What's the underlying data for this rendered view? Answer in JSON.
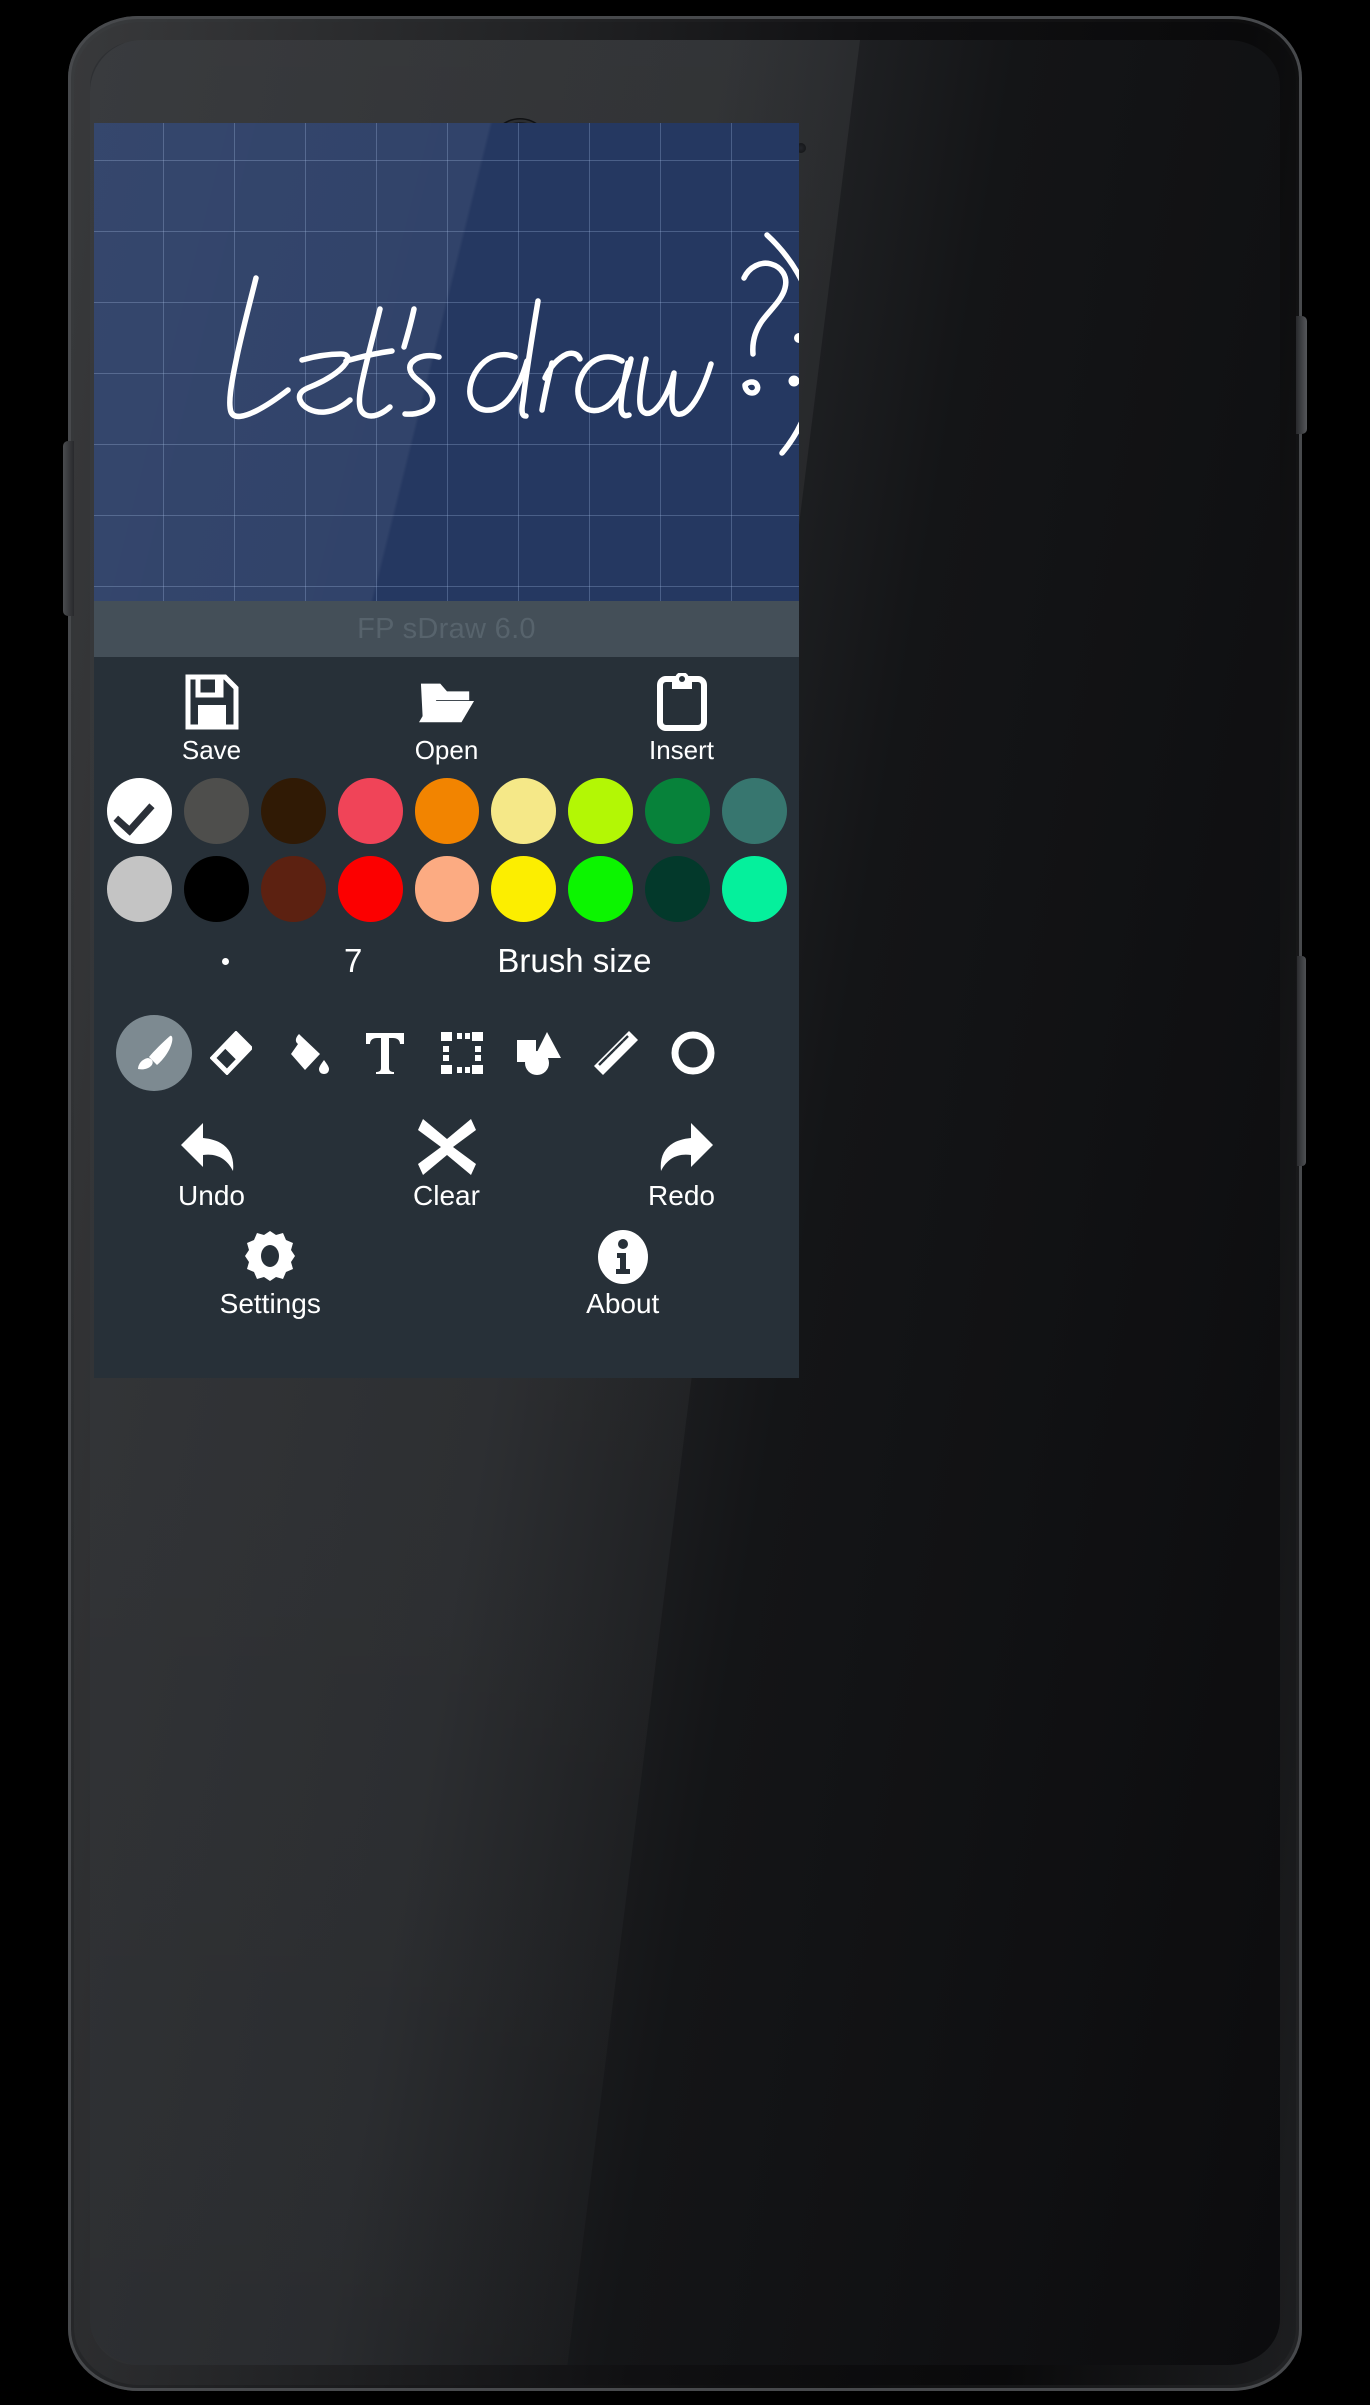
{
  "app": {
    "title": "FP sDraw 6.0"
  },
  "canvas": {
    "handwritten_text": "Let's draw? :)",
    "background_color": "#253861",
    "grid_color": "#a0b9e1",
    "ink_color": "#ffffff"
  },
  "file_actions": [
    {
      "label": "Save",
      "icon": "floppy-disk-icon"
    },
    {
      "label": "Open",
      "icon": "open-folder-icon"
    },
    {
      "label": "Insert",
      "icon": "clipboard-icon"
    }
  ],
  "palette": {
    "selected_index": 0,
    "selected_color": "#ffffff",
    "row1": [
      {
        "name": "white",
        "hex": "#ffffff"
      },
      {
        "name": "dark-gray",
        "hex": "#4e4e4c"
      },
      {
        "name": "dark-brown",
        "hex": "#301a05"
      },
      {
        "name": "crimson-pink",
        "hex": "#f04458"
      },
      {
        "name": "orange",
        "hex": "#f28400"
      },
      {
        "name": "pale-yellow",
        "hex": "#f5e888"
      },
      {
        "name": "chartreuse",
        "hex": "#b3f705"
      },
      {
        "name": "green",
        "hex": "#07823a"
      },
      {
        "name": "teal",
        "hex": "#37766f"
      }
    ],
    "row2": [
      {
        "name": "silver",
        "hex": "#c4c4c4"
      },
      {
        "name": "black",
        "hex": "#000000"
      },
      {
        "name": "maroon-brown",
        "hex": "#5c2111"
      },
      {
        "name": "red",
        "hex": "#fc0000"
      },
      {
        "name": "peach",
        "hex": "#fcab82"
      },
      {
        "name": "yellow",
        "hex": "#fcee00"
      },
      {
        "name": "bright-green",
        "hex": "#0cf500"
      },
      {
        "name": "dark-green",
        "hex": "#03392b"
      },
      {
        "name": "spring-green",
        "hex": "#05f09c"
      }
    ]
  },
  "brush": {
    "size_value": "7",
    "size_label": "Brush size",
    "preview_dot_color": "#ffffff"
  },
  "tools": {
    "selected_index": 0,
    "highlight_color": "#7d8a91",
    "items": [
      {
        "name": "brush-tool",
        "icon": "paint-brush-icon"
      },
      {
        "name": "eraser-tool",
        "icon": "eraser-icon"
      },
      {
        "name": "fill-tool",
        "icon": "paint-bucket-icon"
      },
      {
        "name": "text-tool",
        "icon": "text-t-icon"
      },
      {
        "name": "select-tool",
        "icon": "selection-marquee-icon"
      },
      {
        "name": "shapes-tool",
        "icon": "shapes-icon"
      },
      {
        "name": "ruler-tool",
        "icon": "ruler-icon"
      },
      {
        "name": "circle-tool",
        "icon": "circle-outline-icon"
      }
    ]
  },
  "edit_actions": [
    {
      "label": "Undo",
      "icon": "undo-arrow-icon"
    },
    {
      "label": "Clear",
      "icon": "close-x-icon"
    },
    {
      "label": "Redo",
      "icon": "redo-arrow-icon"
    }
  ],
  "footer_actions": [
    {
      "label": "Settings",
      "icon": "gear-icon"
    },
    {
      "label": "About",
      "icon": "info-circle-icon"
    }
  ]
}
